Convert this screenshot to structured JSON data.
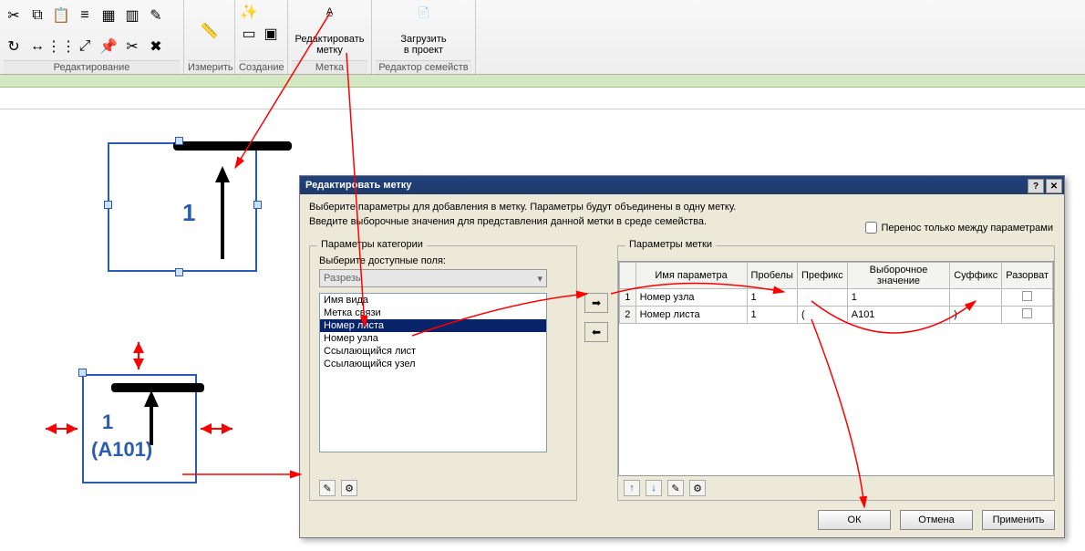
{
  "ribbon": {
    "panels": {
      "edit": "Редактирование",
      "measure": "Измерить",
      "create": "Создание",
      "label": "Метка",
      "family": "Редактор семейств"
    },
    "edit_label_btn": "Редактировать\nметку",
    "load_project_btn": "Загрузить\nв проект"
  },
  "diagram1": {
    "num": "1"
  },
  "diagram2": {
    "num": "1",
    "sheet": "(A101)"
  },
  "dialog": {
    "title": "Редактировать метку",
    "line1": "Выберите параметры для добавления в метку.  Параметры будут объединены в одну метку.",
    "line2": "Введите выборочные значения для представления данной метки в среде семейства.",
    "wrap_chk": "Перенос только между параметрами",
    "grp_cat": "Параметры категории",
    "avail_label": "Выберите доступные поля:",
    "combo_val": "Разрезы",
    "list": {
      "i0": "Имя вида",
      "i1": "Метка связи",
      "i2": "Номер листа",
      "i3": "Номер узла",
      "i4": "Ссылающийся лист",
      "i5": "Ссылающийся узел"
    },
    "grp_lbl": "Параметры метки",
    "cols": {
      "name": "Имя параметра",
      "spaces": "Пробелы",
      "prefix": "Префикс",
      "sample": "Выборочное значение",
      "suffix": "Суффикс",
      "break": "Разорват"
    },
    "rows": {
      "r1": {
        "n": "1",
        "name": "Номер узла",
        "sp": "1",
        "pre": "",
        "samp": "1",
        "suf": "",
        "br": ""
      },
      "r2": {
        "n": "2",
        "name": "Номер листа",
        "sp": "1",
        "pre": "(",
        "samp": "A101",
        "suf": ")",
        "br": ""
      }
    },
    "ok": "ОК",
    "cancel": "Отмена",
    "apply": "Применить"
  }
}
